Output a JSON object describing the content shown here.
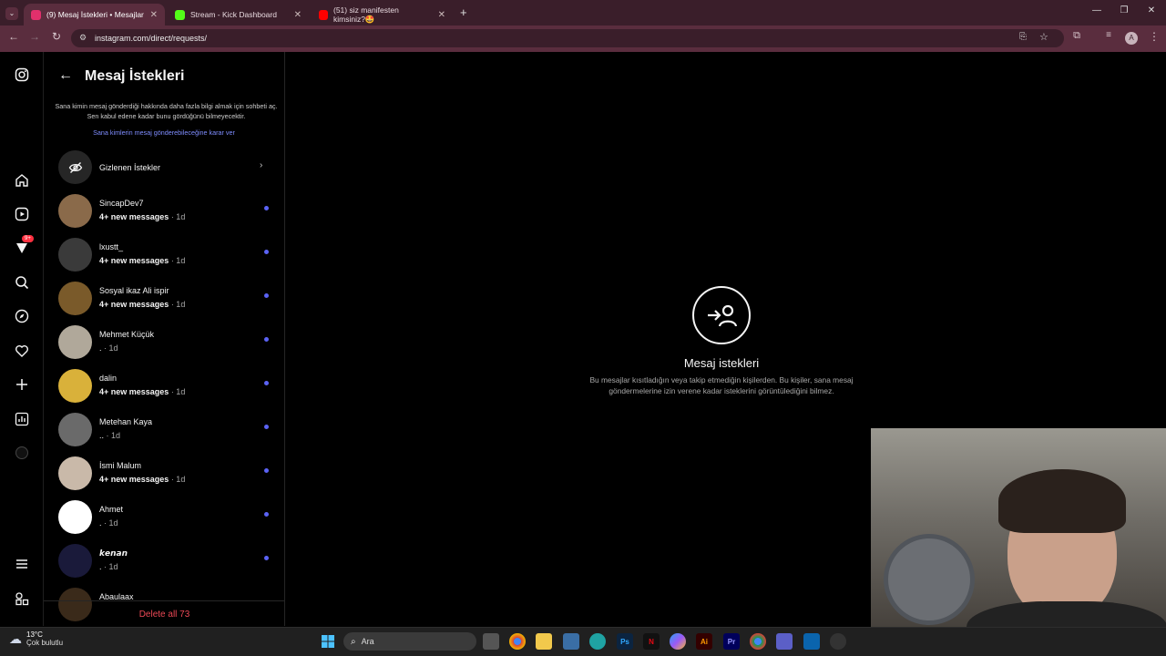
{
  "browser": {
    "tabs": [
      {
        "title": "(9) Mesaj İstekleri • Mesajlar",
        "favicon_color": "#e1306c",
        "active": true
      },
      {
        "title": "Stream - Kick Dashboard",
        "favicon_color": "#53fc18",
        "active": false
      },
      {
        "title": "(51) siz manifesten kimsiniz?🤩",
        "favicon_color": "#ff0000",
        "active": false
      }
    ],
    "url": "instagram.com/direct/requests/",
    "profile_initial": "A"
  },
  "sidebar": {
    "notification_badge": "9+"
  },
  "requests": {
    "title": "Mesaj İstekleri",
    "description": "Sana kimin mesaj gönderdiği hakkında daha fazla bilgi almak için sohbeti aç. Sen kabul edene kadar bunu gördüğünü bilmeyecektir.",
    "decide_link": "Sana kimlerin mesaj gönderebileceğine karar ver",
    "hidden_requests": "Gizlenen İstekler",
    "items": [
      {
        "name": "SincapDev7",
        "preview": "4+ new messages",
        "time": "1d",
        "bold": true,
        "avatar_color": "#8a6a4a"
      },
      {
        "name": "lxustt_",
        "preview": "4+ new messages",
        "time": "1d",
        "bold": true,
        "avatar_color": "#3a3a3a"
      },
      {
        "name": "Sosyal ikaz Ali ispir",
        "preview": "4+ new messages",
        "time": "1d",
        "bold": true,
        "avatar_color": "#7a5a2a"
      },
      {
        "name": "Mehmet Küçük",
        "preview": ".",
        "time": "1d",
        "bold": false,
        "avatar_color": "#b0a89a"
      },
      {
        "name": "dalin",
        "preview": "4+ new messages",
        "time": "1d",
        "bold": true,
        "avatar_color": "#d9b13a"
      },
      {
        "name": "Metehan Kaya",
        "preview": "..",
        "time": "1d",
        "bold": false,
        "avatar_color": "#6a6a6a"
      },
      {
        "name": "İsmi Malum",
        "preview": "4+ new messages",
        "time": "1d",
        "bold": true,
        "avatar_color": "#c9b9a9"
      },
      {
        "name": "Ahmet",
        "preview": ".",
        "time": "1d",
        "bold": false,
        "avatar_color": "#ffffff"
      },
      {
        "name": "𝙠𝙚𝙣𝙖𝙣",
        "preview": ".",
        "time": "1d",
        "bold": false,
        "avatar_color": "#1a1a3a"
      },
      {
        "name": "Abaulaax",
        "preview": "",
        "time": "",
        "bold": false,
        "avatar_color": "#3a2a1a"
      }
    ],
    "delete_all": "Delete all 73"
  },
  "main": {
    "title": "Mesaj istekleri",
    "description": "Bu mesajlar kısıtladığın veya takip etmediğin kişilerden. Bu kişiler, sana mesaj göndermelerine izin verene kadar isteklerini görüntülediğini bilmez."
  },
  "taskbar": {
    "weather_temp": "13°C",
    "weather_desc": "Çok bulutlu",
    "search_placeholder": "Ara"
  }
}
